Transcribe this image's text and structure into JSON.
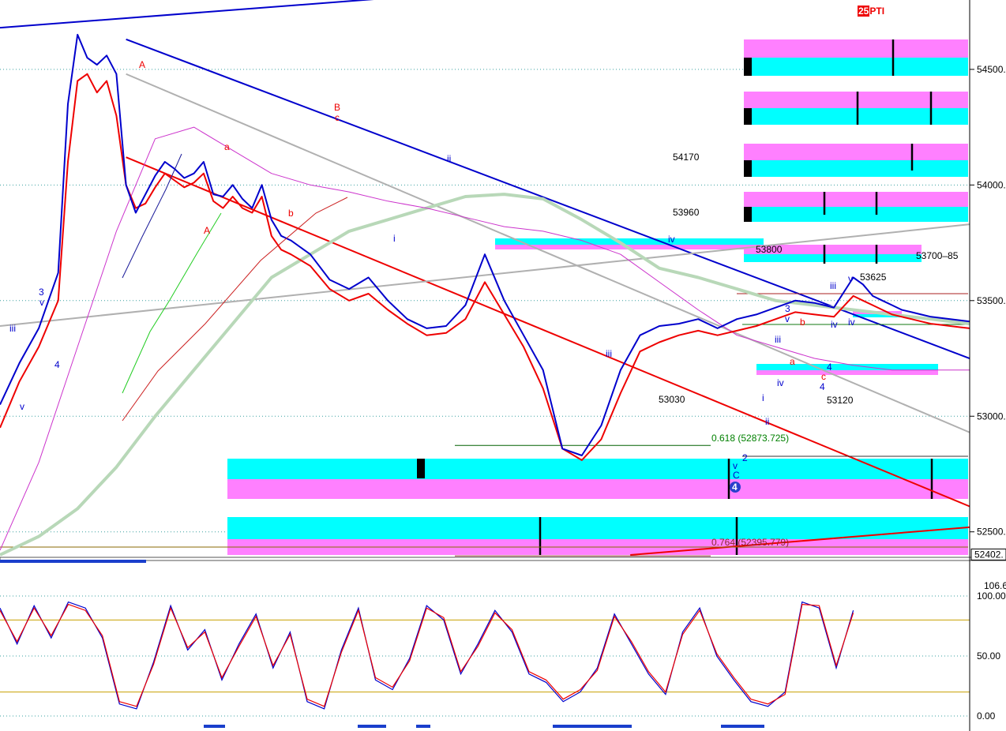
{
  "header": {
    "badge": "25",
    "symbol": "PTI"
  },
  "colors": {
    "cyan": "#00ffff",
    "magenta": "#ff80ff",
    "blue": "#0000cc",
    "red": "#ee0000",
    "black": "#000000",
    "green": "#008000",
    "gray": "#b0b0b0",
    "sage": "#b8d8b8",
    "thin_red": "#cc2222",
    "thin_magenta": "#cc33cc",
    "bright_green": "#22cc22",
    "gold": "#c8a000"
  },
  "chart_data": [
    {
      "type": "line",
      "ylim": [
        52400,
        54800
      ],
      "y_ticks": [
        "54500.",
        "54000.",
        "53500.",
        "53000.",
        "52500."
      ],
      "y_tick_values": [
        54500,
        54000,
        53500,
        53000,
        52500
      ],
      "last_price": "52402.",
      "level_labels": [
        "54170",
        "53960",
        "53800",
        "53700–85",
        "53625",
        "53120",
        "53030"
      ],
      "fib_levels": [
        {
          "label": "0.618 (52873.725)",
          "value": 52873.725
        },
        {
          "label": "0.764 (52395.779)",
          "value": 52395.779
        }
      ],
      "wave_labels": {
        "blue": [
          "iii",
          "v",
          "3",
          "v",
          "4",
          "iv",
          "ii",
          "i",
          "iii",
          "iv",
          "v",
          "C",
          "2",
          "4",
          "i",
          "ii",
          "iii",
          "iv",
          "3",
          "v",
          "4",
          "iii",
          "v",
          "iv"
        ],
        "red": [
          "B",
          "c",
          "a",
          "A",
          "b",
          "A",
          "a",
          "b",
          "c"
        ]
      },
      "series": [
        {
          "line_color": "blue",
          "x": [
            0,
            2,
            4,
            6,
            7,
            8,
            9,
            10,
            11,
            12,
            13,
            14,
            15,
            16,
            17,
            18,
            19,
            20,
            21,
            22,
            23,
            24,
            25,
            26,
            27,
            28,
            29,
            30,
            32,
            34,
            36,
            38,
            40,
            42,
            44,
            46,
            48,
            50,
            52,
            54,
            56,
            58,
            60,
            62,
            64,
            66,
            68,
            70,
            72,
            74,
            76,
            78,
            80,
            82,
            84,
            86,
            88,
            89,
            90,
            91,
            92,
            93,
            94,
            95,
            96,
            97,
            98,
            99,
            100
          ],
          "values": [
            53050,
            53230,
            53380,
            53620,
            54350,
            54650,
            54550,
            54520,
            54560,
            54480,
            54000,
            53880,
            53960,
            54040,
            54100,
            54070,
            54030,
            54050,
            54100,
            53960,
            53950,
            54000,
            53940,
            53900,
            54000,
            53850,
            53780,
            53760,
            53700,
            53590,
            53550,
            53600,
            53500,
            53420,
            53380,
            53390,
            53480,
            53700,
            53500,
            53350,
            53200,
            52860,
            52830,
            52960,
            53200,
            53350,
            53390,
            53400,
            53420,
            53380,
            53420,
            53440,
            53470,
            53500,
            53490,
            53470,
            53600,
            53570,
            53520,
            53500,
            53480,
            53460,
            53450,
            53440,
            53430,
            53425,
            53420,
            53415,
            53410
          ]
        },
        {
          "line_color": "red",
          "x": [
            0,
            2,
            4,
            6,
            7,
            8,
            9,
            10,
            11,
            12,
            13,
            14,
            15,
            16,
            17,
            18,
            19,
            20,
            21,
            22,
            23,
            24,
            25,
            26,
            27,
            28,
            29,
            30,
            32,
            34,
            36,
            38,
            40,
            42,
            44,
            46,
            48,
            50,
            52,
            54,
            56,
            58,
            60,
            62,
            64,
            66,
            68,
            70,
            72,
            74,
            76,
            78,
            80,
            82,
            84,
            86,
            88,
            89,
            90,
            91,
            92,
            93,
            94,
            95,
            96,
            97,
            98,
            99,
            100
          ],
          "values": [
            52950,
            53150,
            53300,
            53500,
            54100,
            54450,
            54480,
            54400,
            54450,
            54300,
            54000,
            53900,
            53920,
            53990,
            54050,
            54020,
            53990,
            54010,
            54050,
            53930,
            53900,
            53950,
            53900,
            53880,
            53950,
            53780,
            53720,
            53700,
            53650,
            53550,
            53500,
            53530,
            53460,
            53400,
            53350,
            53360,
            53420,
            53580,
            53440,
            53300,
            53120,
            52860,
            52810,
            52900,
            53100,
            53280,
            53320,
            53350,
            53370,
            53350,
            53370,
            53390,
            53420,
            53450,
            53440,
            53430,
            53520,
            53500,
            53480,
            53460,
            53440,
            53430,
            53420,
            53410,
            53400,
            53395,
            53390,
            53385,
            53380
          ]
        },
        {
          "line_color": "sage",
          "x": [
            0,
            4,
            8,
            12,
            16,
            20,
            24,
            28,
            32,
            36,
            40,
            44,
            48,
            52,
            56,
            60,
            64,
            68,
            72,
            76,
            80,
            84,
            88,
            92,
            96,
            100
          ],
          "values": [
            52400,
            52480,
            52600,
            52780,
            53000,
            53200,
            53400,
            53600,
            53700,
            53800,
            53850,
            53900,
            53950,
            53960,
            53940,
            53850,
            53750,
            53640,
            53600,
            53550,
            53500,
            53480,
            53460,
            53440,
            53420,
            53400
          ]
        },
        {
          "line_color": "thin_magenta",
          "x": [
            0,
            4,
            8,
            12,
            16,
            20,
            24,
            28,
            32,
            36,
            40,
            44,
            48,
            52,
            56,
            60,
            64,
            68,
            72,
            76,
            80,
            84,
            88,
            92,
            96,
            100
          ],
          "values": [
            52420,
            52800,
            53300,
            53800,
            54200,
            54250,
            54150,
            54050,
            54000,
            53970,
            53930,
            53900,
            53860,
            53820,
            53800,
            53760,
            53700,
            53580,
            53460,
            53350,
            53300,
            53250,
            53220,
            53200,
            53200,
            53200
          ]
        }
      ],
      "trend_lines": [
        {
          "line_color": "blue",
          "x": [
            0,
            50
          ],
          "values": [
            54680,
            54840
          ]
        },
        {
          "line_color": "blue",
          "x": [
            13,
            100
          ],
          "values": [
            54630,
            53250
          ]
        },
        {
          "line_color": "red",
          "x": [
            13,
            100
          ],
          "values": [
            54120,
            52610
          ]
        },
        {
          "line_color": "gray",
          "x": [
            0,
            100
          ],
          "values": [
            53390,
            53830
          ]
        },
        {
          "line_color": "gray",
          "x": [
            13,
            100
          ],
          "values": [
            54480,
            52930
          ]
        },
        {
          "line_color": "red",
          "x": [
            65,
            100
          ],
          "values": [
            52400,
            52520
          ]
        }
      ]
    },
    {
      "type": "line",
      "ylim": [
        0,
        100
      ],
      "y_ticks": [
        "100.00",
        "50.00",
        "0.00"
      ],
      "y_tick_values": [
        100,
        50,
        0
      ],
      "last_value": "106.6",
      "reference_lines": [
        80,
        20
      ],
      "series": [
        {
          "line_color": "blue",
          "x": [
            0,
            2,
            4,
            6,
            8,
            10,
            12,
            14,
            16,
            18,
            20,
            22,
            24,
            26,
            28,
            30,
            32,
            34,
            36,
            38,
            40,
            42,
            44,
            46,
            48,
            50,
            52,
            54,
            56,
            58,
            60,
            62,
            64,
            66,
            68,
            70,
            72,
            74,
            76,
            78,
            80,
            82,
            84,
            86,
            88,
            90,
            92,
            94,
            96,
            98,
            100
          ],
          "values": [
            90,
            60,
            92,
            65,
            95,
            90,
            65,
            10,
            6,
            45,
            92,
            55,
            72,
            30,
            60,
            85,
            40,
            70,
            12,
            6,
            55,
            90,
            30,
            22,
            48,
            92,
            80,
            35,
            60,
            88,
            70,
            35,
            28,
            12,
            20,
            40,
            85,
            60,
            35,
            18,
            70,
            90,
            50,
            30,
            12,
            8,
            20,
            95,
            90,
            40,
            88
          ]
        },
        {
          "line_color": "red",
          "x": [
            0,
            2,
            4,
            6,
            8,
            10,
            12,
            14,
            16,
            18,
            20,
            22,
            24,
            26,
            28,
            30,
            32,
            34,
            36,
            38,
            40,
            42,
            44,
            46,
            48,
            50,
            52,
            54,
            56,
            58,
            60,
            62,
            64,
            66,
            68,
            70,
            72,
            74,
            76,
            78,
            80,
            82,
            84,
            86,
            88,
            90,
            92,
            94,
            96,
            98,
            100
          ],
          "values": [
            88,
            62,
            90,
            67,
            93,
            88,
            67,
            12,
            8,
            43,
            90,
            57,
            70,
            32,
            58,
            83,
            42,
            68,
            14,
            8,
            53,
            88,
            32,
            24,
            46,
            90,
            82,
            37,
            58,
            86,
            72,
            37,
            30,
            14,
            22,
            38,
            83,
            62,
            37,
            20,
            68,
            88,
            52,
            32,
            14,
            10,
            18,
            93,
            92,
            42,
            86
          ]
        }
      ]
    }
  ]
}
